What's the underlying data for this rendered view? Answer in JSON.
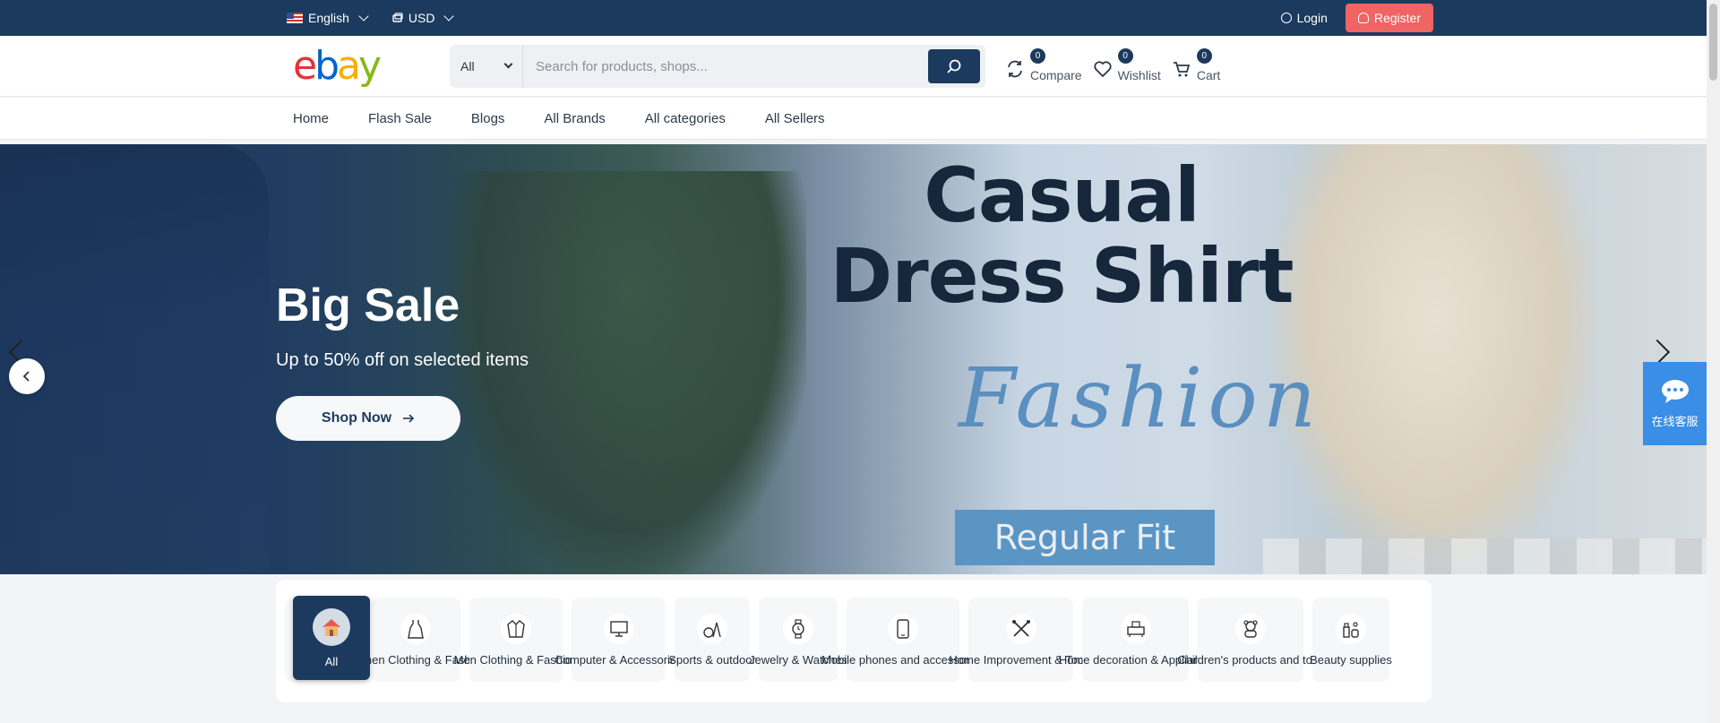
{
  "topbar": {
    "language": "English",
    "currency": "USD",
    "login": "Login",
    "register": "Register"
  },
  "header": {
    "logo": {
      "e": "e",
      "b": "b",
      "a": "a",
      "y": "y"
    },
    "search_category": "All",
    "search_placeholder": "Search for products, shops...",
    "compare_label": "Compare",
    "compare_count": "0",
    "wishlist_label": "Wishlist",
    "wishlist_count": "0",
    "cart_label": "Cart",
    "cart_count": "0"
  },
  "nav": [
    "Home",
    "Flash Sale",
    "Blogs",
    "All Brands",
    "All categories",
    "All Sellers"
  ],
  "hero": {
    "title": "Big Sale",
    "subtitle": "Up to 50% off on selected items",
    "cta": "Shop Now",
    "banner_line1": "Casual",
    "banner_line2": "Dress Shirt",
    "banner_script": "Fashion",
    "banner_tag": "Regular Fit"
  },
  "chat_label": "在线客服",
  "categories": {
    "all": "All",
    "items": [
      {
        "name": "Women Clothing & Fashion",
        "icon": "dress-icon"
      },
      {
        "name": "Men Clothing & Fashion",
        "icon": "jacket-icon"
      },
      {
        "name": "Computer & Accessories",
        "icon": "computer-icon"
      },
      {
        "name": "Sports & outdoor",
        "icon": "sports-icon"
      },
      {
        "name": "Jewelry & Watches",
        "icon": "watch-icon"
      },
      {
        "name": "Mobile phones and accessories",
        "icon": "phone-icon"
      },
      {
        "name": "Home Improvement & Tools",
        "icon": "tools-icon"
      },
      {
        "name": "Home decoration & Appliance",
        "icon": "appliance-icon"
      },
      {
        "name": "Children's products and toys",
        "icon": "toys-icon"
      },
      {
        "name": "Beauty supplies",
        "icon": "beauty-icon"
      }
    ]
  }
}
